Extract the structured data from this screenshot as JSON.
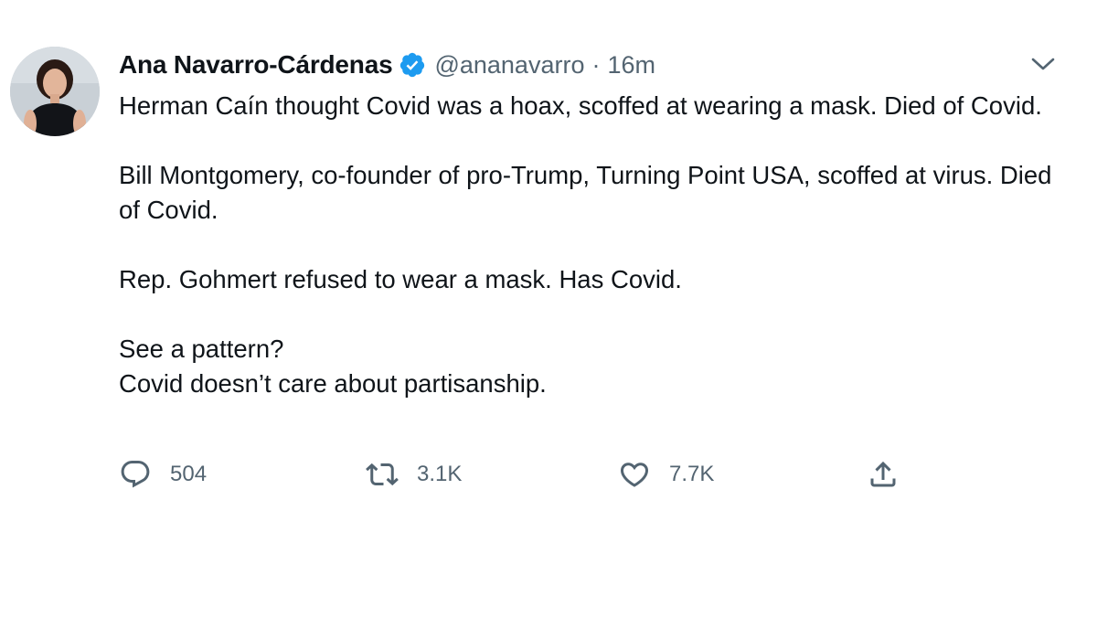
{
  "tweet": {
    "author": {
      "display_name": "Ana Navarro-Cárdenas",
      "handle": "@ananavarro",
      "verified": true
    },
    "separator": "·",
    "time": "16m",
    "paragraphs": [
      [
        "Herman Caín thought Covid was a hoax, scoffed at wearing a mask. Died of Covid."
      ],
      [
        "Bill Montgomery, co-founder of pro-Trump, Turning Point USA, scoffed at virus. Died of Covid."
      ],
      [
        "Rep. Gohmert refused to wear a mask. Has Covid."
      ],
      [
        "See a pattern?",
        "Covid doesn’t care about partisanship."
      ]
    ],
    "actions": {
      "reply_count": "504",
      "retweet_count": "3.1K",
      "like_count": "7.7K"
    }
  },
  "icons": {
    "verified": "verified-badge-icon",
    "more": "chevron-down-icon",
    "reply": "reply-icon",
    "retweet": "retweet-icon",
    "like": "heart-icon",
    "share": "share-icon"
  },
  "colors": {
    "text": "#0f1419",
    "secondary": "#536471",
    "verified_blue": "#1d9bf0",
    "background": "#ffffff"
  }
}
